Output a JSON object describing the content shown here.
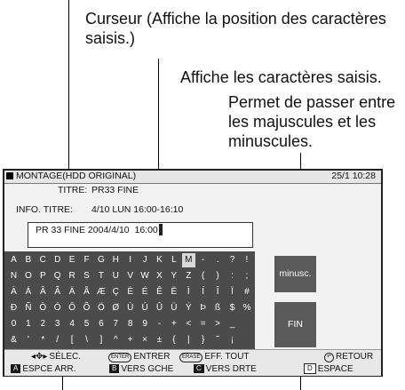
{
  "annotations": {
    "cursor": "Curseur (Affiche la position des caractères saisis.)",
    "display": "Affiche les caractères saisis.",
    "case": "Permet de passer entre les majuscules et les minuscules."
  },
  "screen": {
    "mode_title": "MONTAGE(HDD ORIGINAL)",
    "clock": "25/1  10:28",
    "title_label": "TITRE:",
    "title_value": "PR33 FINE",
    "info_label": "INFO. TITRE:",
    "info_value": "4/10 LUN 16:00-16:10",
    "input_text": "PR 33 FINE 2004/4/10  16:00",
    "selected_key": "M",
    "keyboard_rows": [
      [
        "A",
        "B",
        "C",
        "D",
        "E",
        "F",
        "G",
        "H",
        "I",
        "J",
        "K",
        "L",
        "M",
        "-",
        ".",
        "?",
        "!"
      ],
      [
        "N",
        "O",
        "P",
        "Q",
        "R",
        "S",
        "T",
        "U",
        "V",
        "W",
        "X",
        "Y",
        "Z",
        "(",
        ")",
        ":",
        ";"
      ],
      [
        "À",
        "Á",
        "Â",
        "Ã",
        "Ä",
        "Å",
        "Æ",
        "Ç",
        "È",
        "É",
        "Ê",
        "Ë",
        "Ì",
        "Í",
        "Î",
        "Ï",
        "#"
      ],
      [
        "Ð",
        "Ñ",
        "Ò",
        "Ó",
        "Ô",
        "Õ",
        "Ö",
        "Ø",
        "Ù",
        "Ú",
        "Û",
        "Ü",
        "Ý",
        "Þ",
        "ß",
        "$",
        "%"
      ],
      [
        "0",
        "1",
        "2",
        "3",
        "4",
        "5",
        "6",
        "7",
        "8",
        "9",
        "-",
        "+",
        "<",
        "=",
        ">",
        "_",
        ""
      ],
      [
        "&",
        "'",
        "*",
        "/",
        "[",
        "\\",
        "]",
        "^",
        "+",
        "×",
        "±",
        "{",
        "|",
        "}",
        "˜",
        "¡",
        ""
      ]
    ],
    "case_button": "minusc.",
    "end_button": "FIN",
    "help": {
      "select": "SÉLEC.",
      "enter_icon": "ENTER",
      "enter": "ENTRER",
      "erase_icon": "ERASE",
      "erase_all": "EFF. TOUT",
      "return": "RETOUR",
      "a_key": "A",
      "backspace": "ESPCE ARR.",
      "b_key": "B",
      "left": "VERS GCHE",
      "c_key": "C",
      "right": "VERS DRTE",
      "d_key": "D",
      "space": "ESPACE"
    }
  }
}
